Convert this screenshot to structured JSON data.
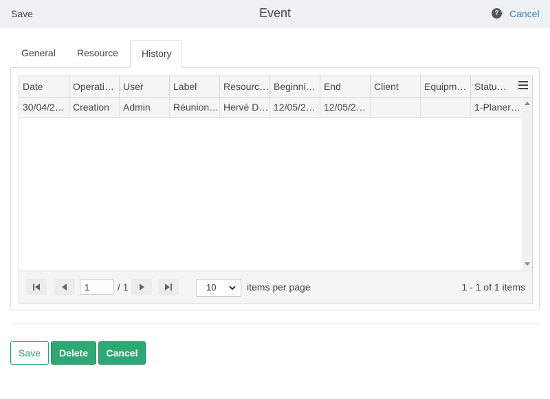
{
  "header": {
    "save_label": "Save",
    "title": "Event",
    "help_glyph": "?",
    "cancel_label": "Cancel"
  },
  "tabs": [
    {
      "label": "General",
      "active": false
    },
    {
      "label": "Resource",
      "active": false
    },
    {
      "label": "History",
      "active": true
    }
  ],
  "grid": {
    "columns": [
      "Date",
      "Operati…",
      "User",
      "Label",
      "Resourc…",
      "Beginni…",
      "End",
      "Client",
      "Equipm…",
      "Statu…"
    ],
    "rows": [
      [
        "30/04/2…",
        "Creation",
        "Admin",
        "Réunion…",
        "Hervé D…",
        "12/05/2…",
        "12/05/2…",
        "",
        "",
        "1-Planer…"
      ]
    ]
  },
  "pager": {
    "page": "1",
    "of_label": "/ 1",
    "page_size": "10",
    "items_per_page_label": "items per page",
    "items_info": "1 - 1 of 1 items"
  },
  "footer": {
    "save_label": "Save",
    "delete_label": "Delete",
    "cancel_label": "Cancel"
  },
  "colors": {
    "accent_green": "#2fa874",
    "link_blue": "#3a7fc1"
  }
}
